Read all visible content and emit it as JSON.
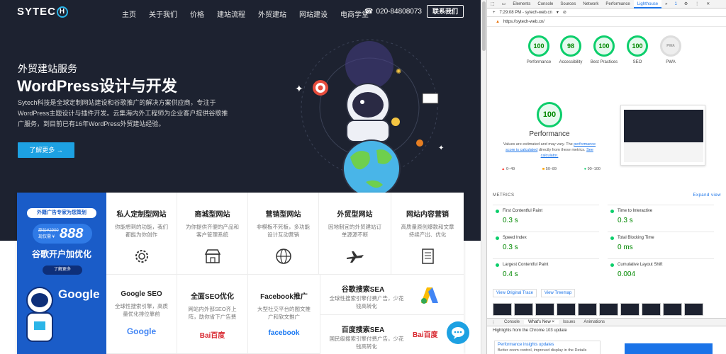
{
  "site": {
    "logo": {
      "text": "SYTEC",
      "mark": "H"
    },
    "menu": [
      "主页",
      "关于我们",
      "价格",
      "建站流程",
      "外贸建站",
      "网站建设",
      "电商学堂"
    ],
    "phone": "020-84808073",
    "contact_button": "联系我们",
    "hero": {
      "subtitle": "外贸建站服务",
      "title": "WordPress设计与开发",
      "description": "Sytech科技是全球定制网站建设和谷歌推广的解决方案供应商，专注于WordPress主题设计与插件开发。云集海内外工程师为企业客户提供谷歌推广服务，到目前已有16年WordPress外贸建站经验。",
      "button": "了解更多 →"
    },
    "promo": {
      "tag": "外籍广告专家为您策划",
      "old_price": "原价¥2900",
      "now_label": "现仅需 ¥",
      "price": "888",
      "headline": "谷歌开户加优化",
      "button": "了解更多",
      "google": "Google"
    },
    "cards_row1": [
      {
        "title": "私人定制型网站",
        "desc": "你能想到的功能，我们都能为你创作",
        "icon": "gear-icon"
      },
      {
        "title": "商城型网站",
        "desc": "为你提供齐便的产品和客户管理系统",
        "icon": "store-icon"
      },
      {
        "title": "营销型网站",
        "desc": "非模板不死板，多功能设计互动营销",
        "icon": "globe-icon"
      },
      {
        "title": "外贸型网站",
        "desc": "因地制宜的外贸建站订单源源不断",
        "icon": "airplane-icon"
      },
      {
        "title": "网站内容营销",
        "desc": "高质量原创爆款和文章持续产出、优化",
        "icon": "document-icon"
      }
    ],
    "cards_row2": [
      {
        "title": "Google SEO",
        "desc": "全球性搜索引擎，高质量优化排位靠前",
        "brand": "Google"
      },
      {
        "title": "全面SEO优化",
        "desc": "网站内外部SEO齐上阵，助你省下广告费",
        "brand": "Bai百度"
      },
      {
        "title": "Facebook推广",
        "desc": "大型社交平台的图文推广和软文推广",
        "brand": "facebook"
      }
    ],
    "sea": [
      {
        "title": "谷歌搜索SEA",
        "desc": "全球性搜索引擎付费广告，少花钱高转化",
        "logo": "google-ads-icon"
      },
      {
        "title": "百度搜索SEA",
        "desc": "国民级搜索引擎付费广告，少花钱高转化",
        "logo": "baidu-logo"
      }
    ]
  },
  "devtools": {
    "tabs": [
      "Elements",
      "Console",
      "Sources",
      "Network",
      "Performance",
      "Lighthouse",
      "»"
    ],
    "active_tab": "Lighthouse",
    "badge": "1",
    "report_time": "7:29:08 PM - sytech-web.cn",
    "url": "https://sytech-web.cn/",
    "scores": [
      {
        "label": "Performance",
        "value": "100"
      },
      {
        "label": "Accessibility",
        "value": "98"
      },
      {
        "label": "Best Practices",
        "value": "100"
      },
      {
        "label": "SEO",
        "value": "100"
      },
      {
        "label": "PWA",
        "value": "PWA"
      }
    ],
    "performance": {
      "score": "100",
      "title": "Performance",
      "note_pre": "Values are estimated and may vary. The",
      "note_link1": "performance score is calculated",
      "note_mid": "directly from these metrics.",
      "note_link2": "See calculator.",
      "legend": [
        "0–49",
        "50–89",
        "90–100"
      ]
    },
    "metrics_header": "METRICS",
    "expand_view": "Expand view",
    "metrics": [
      {
        "name": "First Contentful Paint",
        "value": "0.3 s"
      },
      {
        "name": "Time to Interactive",
        "value": "0.3 s"
      },
      {
        "name": "Speed Index",
        "value": "0.3 s"
      },
      {
        "name": "Total Blocking Time",
        "value": "0 ms"
      },
      {
        "name": "Largest Contentful Paint",
        "value": "0.4 s"
      },
      {
        "name": "Cumulative Layout Shift",
        "value": "0.004"
      }
    ],
    "view_trace": "View Original Trace",
    "view_treemap": "View Treemap",
    "drawer_tabs": [
      "Console",
      "What's New ×",
      "Issues",
      "Animations"
    ],
    "drawer_active": "What's New ×",
    "drawer_heading": "Highlights from the Chrome 103 update",
    "drawer_card_title": "Performance insights updates",
    "drawer_card_desc": "Better zoom control, improved display in the Details"
  },
  "colors": {
    "accent": "#1da1e2",
    "good": "#0cce6b",
    "devtools_blue": "#1a73e8"
  }
}
